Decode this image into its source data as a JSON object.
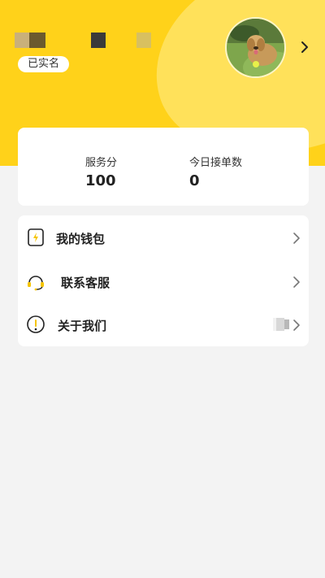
{
  "profile": {
    "verified_badge": "已实名",
    "avatar_icon": "dog-photo"
  },
  "stats": {
    "service_score_label": "服务分",
    "service_score_value": "100",
    "today_orders_label": "今日接单数",
    "today_orders_value": "0"
  },
  "menu": {
    "items": [
      {
        "label": "我的钱包",
        "icon": "wallet-icon"
      },
      {
        "label": "联系客服",
        "icon": "headset-icon"
      },
      {
        "label": "关于我们",
        "icon": "info-icon"
      }
    ]
  },
  "colors": {
    "accent": "#ffd21a",
    "accent_light": "#ffe15a",
    "background": "#f3f3f3"
  }
}
